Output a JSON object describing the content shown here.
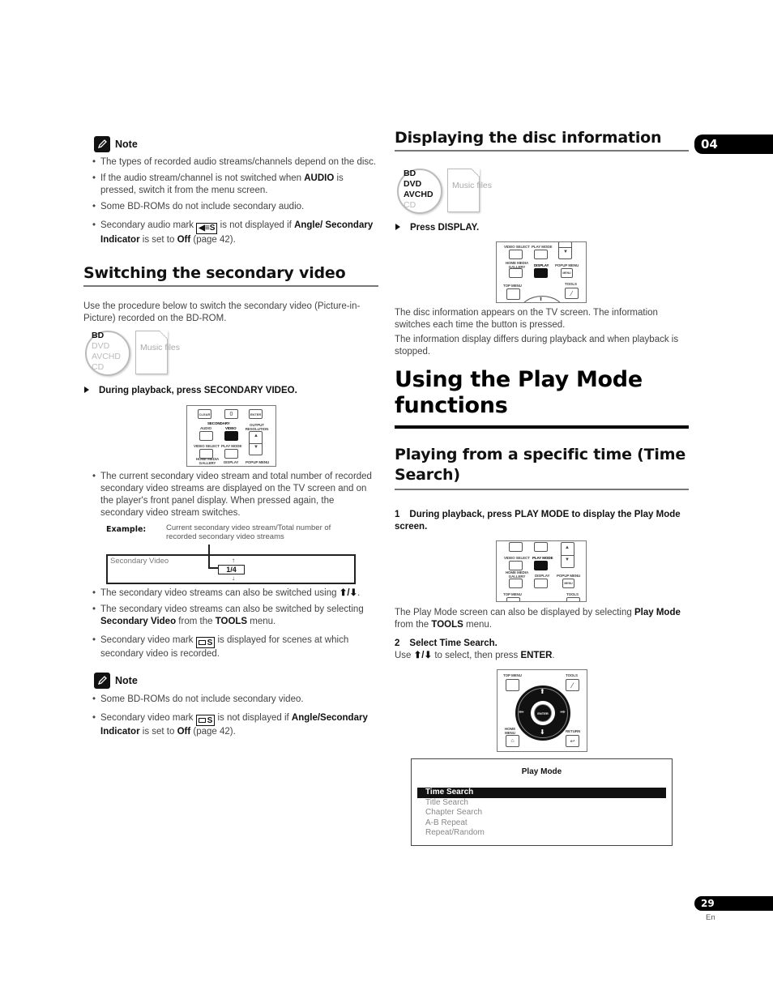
{
  "left_column": {
    "note1": {
      "heading": "Note",
      "items": [
        {
          "parts": [
            "The types of recorded audio streams/channels depend on the disc."
          ]
        },
        {
          "pre": "If the audio stream/channel is not switched when ",
          "bold": "AUDIO",
          "post": " is pressed, switch it from the menu screen."
        },
        {
          "parts": [
            "Some BD-ROMs do not include secondary audio."
          ]
        },
        {
          "pre": "Secondary audio mark ",
          "mark": "secondary-audio-mark",
          "mid": " is not displayed if ",
          "bold1": "Angle/ Secondary Indicator",
          "mid2": " is set to ",
          "bold2": "Off",
          "post": " (page 42)."
        }
      ]
    },
    "section_title": "Switching the secondary video",
    "intro": "Use the procedure below to switch the secondary video (Picture-in-Picture) recorded on the BD-ROM.",
    "disc_types": {
      "active": [
        "BD"
      ],
      "inactive": [
        "DVD",
        "AVCHD",
        "CD"
      ],
      "file_label": "Music files"
    },
    "step": "During playback, press SECONDARY VIDEO.",
    "remote": {
      "buttons_top": [
        "CLEAR",
        "0",
        "ENTER"
      ],
      "group_label": "SECONDARY",
      "labels_row1": [
        "AUDIO",
        "VIDEO",
        "OUTPUT RESOLUTION"
      ],
      "labels_row2": [
        "VIDEO SELECT",
        "PLAY MODE"
      ],
      "labels_row3": [
        "HOME MEDIA GALLERY",
        "DISPLAY",
        "POPUP MENU"
      ],
      "highlighted": "VIDEO"
    },
    "bullet_current": "The current secondary video stream and total number of recorded secondary video streams are displayed on the TV screen and on the player's front panel display. When pressed again, the secondary video stream switches.",
    "example": {
      "label": "Example:",
      "caption": "Current secondary video stream/Total number of recorded secondary video streams",
      "screen_label": "Secondary Video",
      "value": "1/4"
    },
    "bullets2": [
      {
        "pre": "The secondary video streams can also be switched using ",
        "post": "."
      },
      {
        "pre": "The secondary video streams can also be switched by selecting ",
        "bold1": "Secondary Video",
        "mid": " from the ",
        "bold2": "TOOLS",
        "post": " menu."
      },
      {
        "pre": "Secondary video mark ",
        "post": " is displayed for scenes at which secondary video is recorded."
      }
    ],
    "note2": {
      "heading": "Note",
      "item1": "Some BD-ROMs do not include secondary video.",
      "item2": {
        "pre": "Secondary video mark ",
        "mid": " is not displayed if ",
        "bold1": "Angle/Secondary Indicator",
        "mid2": " is set to ",
        "bold2": "Off",
        "post": " (page 42)."
      }
    }
  },
  "right_column": {
    "section_title": "Displaying the disc information",
    "chapter_tab": "04",
    "disc_types": {
      "active": [
        "BD",
        "DVD",
        "AVCHD"
      ],
      "inactive": [
        "CD"
      ],
      "file_label": "Music files"
    },
    "step": "Press DISPLAY.",
    "remote": {
      "labels_row1": [
        "VIDEO SELECT",
        "PLAY MODE"
      ],
      "labels_row2": [
        "HOME MEDIA GALLERY",
        "DISPLAY",
        "POPUP MENU"
      ],
      "menu_btn": "MENU",
      "labels_row3": [
        "TOP MENU",
        "TOOLS"
      ],
      "highlighted": "DISPLAY"
    },
    "para1": "The disc information appears on the TV screen. The information switches each time the button is pressed.",
    "para2": "The information display differs during playback and when playback is stopped.",
    "main_title": "Using the Play Mode functions",
    "sub_title": "Playing from a specific time (Time Search)",
    "step1": {
      "num": "1",
      "text": "During playback, press PLAY MODE to display the Play Mode screen."
    },
    "remote2": {
      "labels_row1": [
        "VIDEO SELECT",
        "PLAY MODE"
      ],
      "labels_row2": [
        "HOME MEDIA GALLERY",
        "DISPLAY",
        "POPUP MENU"
      ],
      "menu_btn": "MENU",
      "labels_row3": [
        "TOP MENU",
        "TOOLS"
      ],
      "highlighted": "PLAY MODE"
    },
    "para3": {
      "pre": "The Play Mode screen can also be displayed by selecting ",
      "bold1": "Play Mode",
      "mid": " from the ",
      "bold2": "TOOLS",
      "post": " menu."
    },
    "step2": {
      "num": "2",
      "text": "Select Time Search.",
      "sub_pre": "Use ",
      "sub_mid": " to select, then press ",
      "sub_bold": "ENTER",
      "sub_post": "."
    },
    "remote3": {
      "labels": [
        "TOP MENU",
        "TOOLS",
        "HOME MENU",
        "RETURN"
      ],
      "center": "ENTER"
    },
    "play_mode_screen": {
      "title": "Play Mode",
      "items": [
        "Time Search",
        "Title Search",
        "Chapter Search",
        "A-B Repeat",
        "Repeat/Random"
      ],
      "selected_index": 0
    }
  },
  "footer": {
    "page_number": "29",
    "language": "En"
  }
}
